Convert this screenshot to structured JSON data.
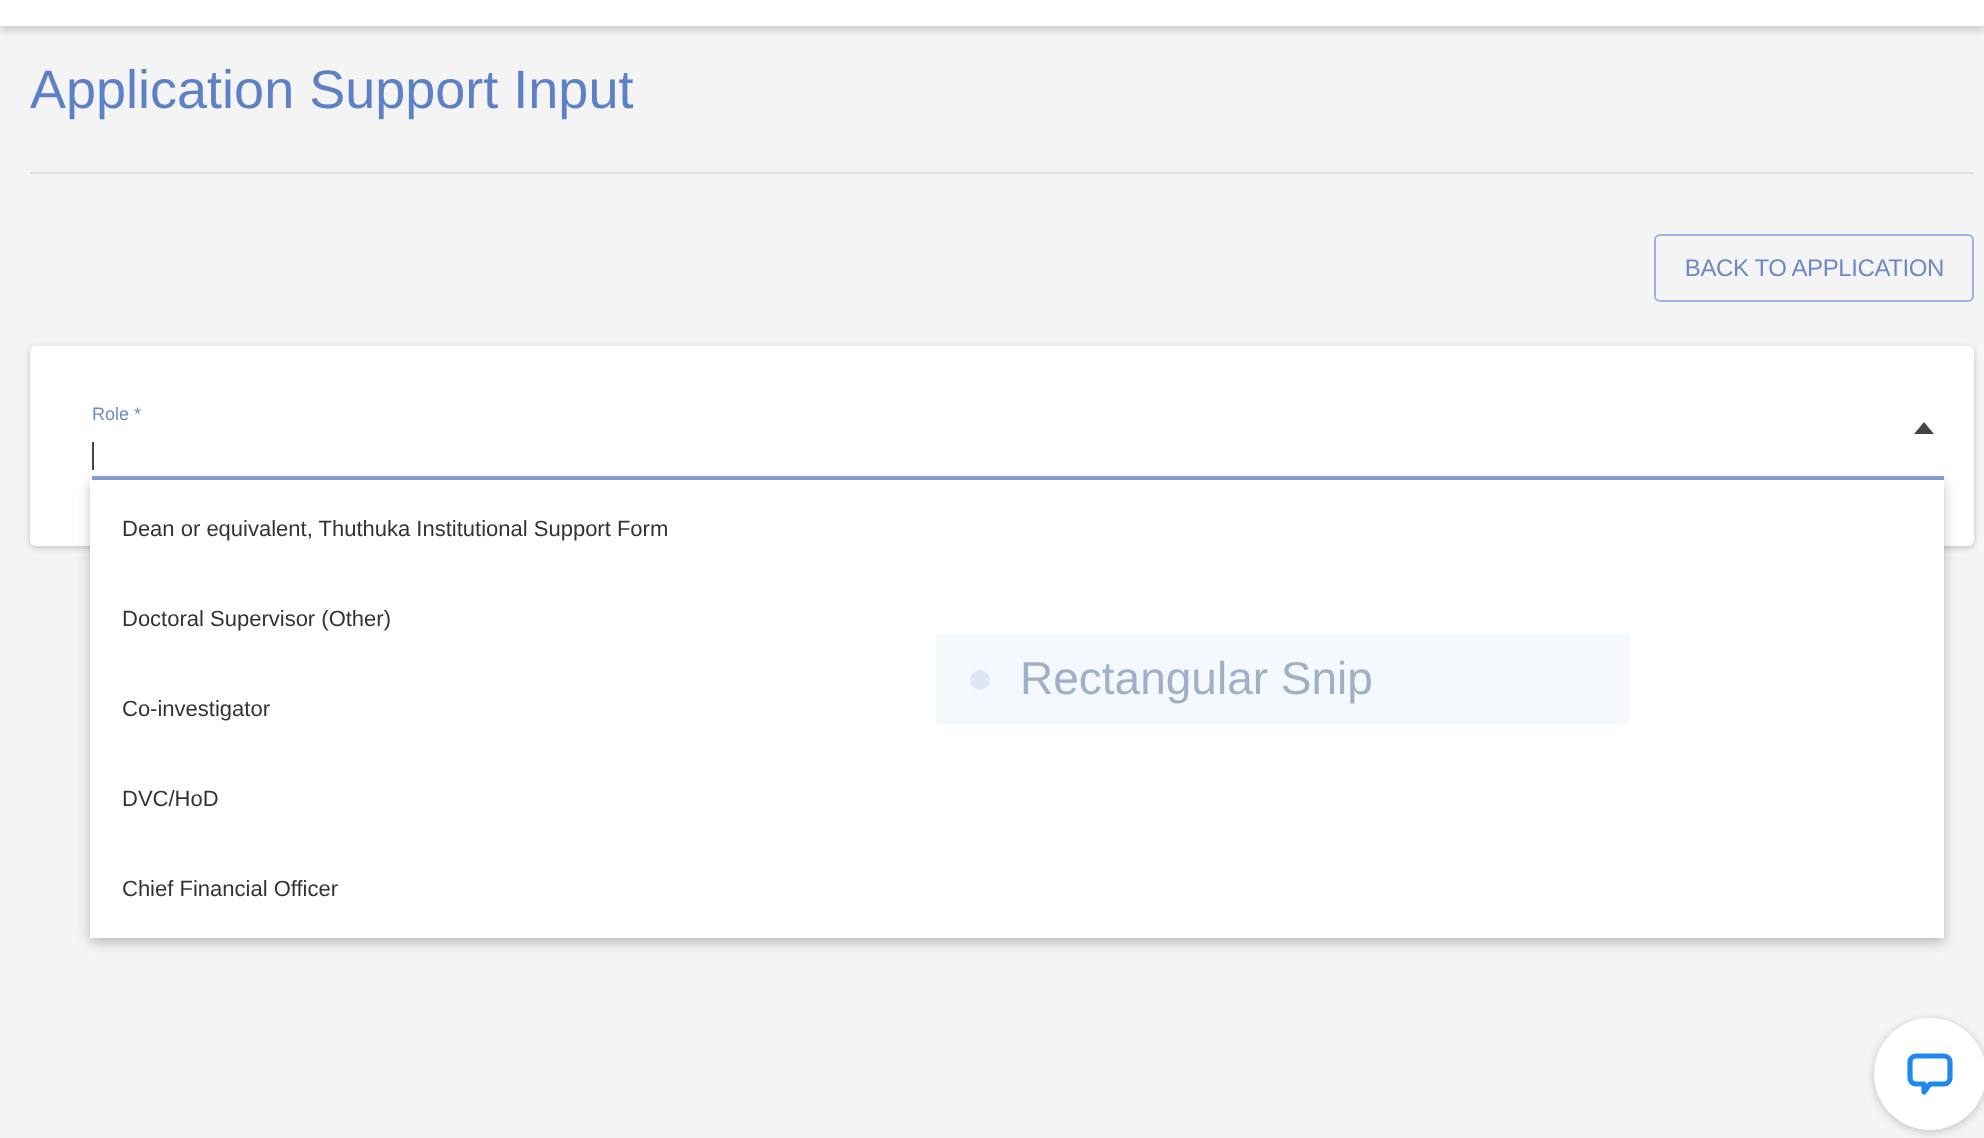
{
  "page": {
    "title": "Application Support Input"
  },
  "back_button": {
    "label": "BACK TO APPLICATION"
  },
  "role_field": {
    "label": "Role *",
    "expanded": true
  },
  "role_options": [
    {
      "label": "Dean or equivalent, Thuthuka Institutional Support Form",
      "selected": false
    },
    {
      "label": "Doctoral Supervisor (Other)",
      "selected": false
    },
    {
      "label": "Co-investigator",
      "selected": false
    },
    {
      "label": "DVC/HoD",
      "selected": false
    },
    {
      "label": "Chief Financial Officer",
      "selected": false
    }
  ],
  "snip_overlay": {
    "label": "Rectangular Snip"
  }
}
